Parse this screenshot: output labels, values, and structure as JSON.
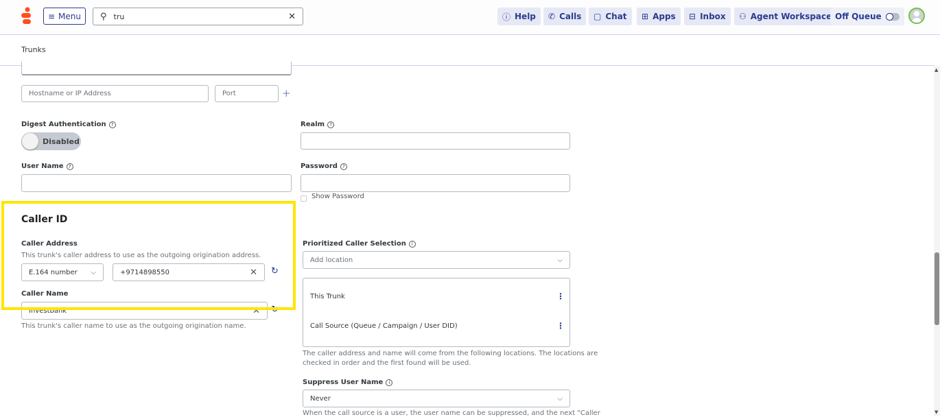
{
  "header": {
    "menu_label": "Menu",
    "search_value": "tru",
    "buttons": [
      {
        "icon": "help-icon",
        "label": "Help"
      },
      {
        "icon": "phone-icon",
        "label": "Calls"
      },
      {
        "icon": "chat-icon",
        "label": "Chat"
      },
      {
        "icon": "apps-icon",
        "label": "Apps"
      },
      {
        "icon": "inbox-icon",
        "label": "Inbox"
      },
      {
        "icon": "agent-icon",
        "label": "Agent Workspace"
      }
    ],
    "queue_label": "Off Queue"
  },
  "breadcrumb": "Trunks",
  "form": {
    "hostname_placeholder": "Hostname or IP Address",
    "port_placeholder": "Port",
    "digest_label": "Digest Authentication",
    "digest_state": "Disabled",
    "realm_label": "Realm",
    "username_label": "User Name",
    "password_label": "Password",
    "show_password": "Show Password",
    "caller_id_title": "Caller ID",
    "caller_address_label": "Caller Address",
    "caller_address_help": "This trunk's caller address to use as the outgoing origination address.",
    "address_type": "E.164 number",
    "address_value": "+9714898550",
    "caller_name_label": "Caller Name",
    "caller_name_value": "Investbank",
    "caller_name_help": "This trunk's caller name to use as the outgoing origination name.",
    "prioritized_label": "Prioritized Caller Selection",
    "add_location": "Add location",
    "locations": [
      "This Trunk",
      "Call Source (Queue / Campaign / User DID)"
    ],
    "prioritized_help_1": "The caller address and name will come from the following locations. The locations are",
    "prioritized_help_2": "checked in order and the first found will be used.",
    "suppress_label": "Suppress User Name",
    "suppress_value": "Never",
    "suppress_help": "When the call source is a user, the user name can be suppressed, and the next \"Caller"
  },
  "colors": {
    "accent": "#2a3c8e",
    "highlight": "#ffe500",
    "brand": "#ff4f1f"
  }
}
